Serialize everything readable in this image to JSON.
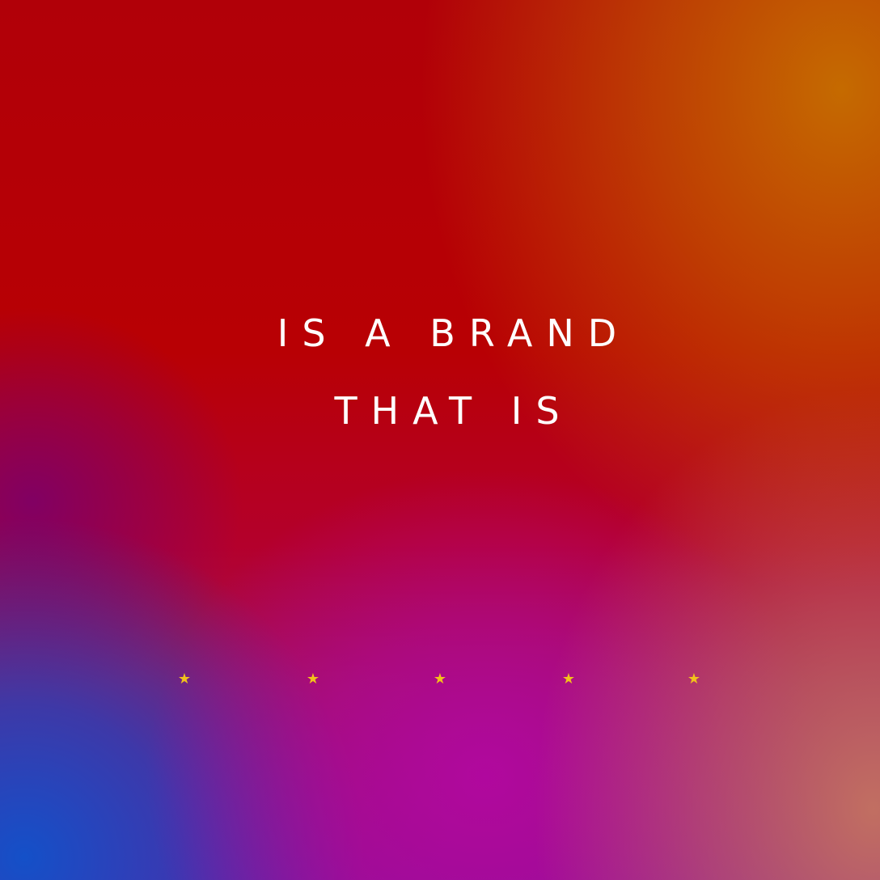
{
  "headline": {
    "line1": "IS A BRAND",
    "line2": "THAT IS"
  },
  "rating": {
    "icon": "star-icon",
    "count": 5,
    "color": "#f2c21b"
  },
  "colors": {
    "red": "#b80004",
    "orange": "#c67000",
    "magenta": "#b208a0",
    "blue": "#1450c8",
    "peach": "#c47460"
  }
}
